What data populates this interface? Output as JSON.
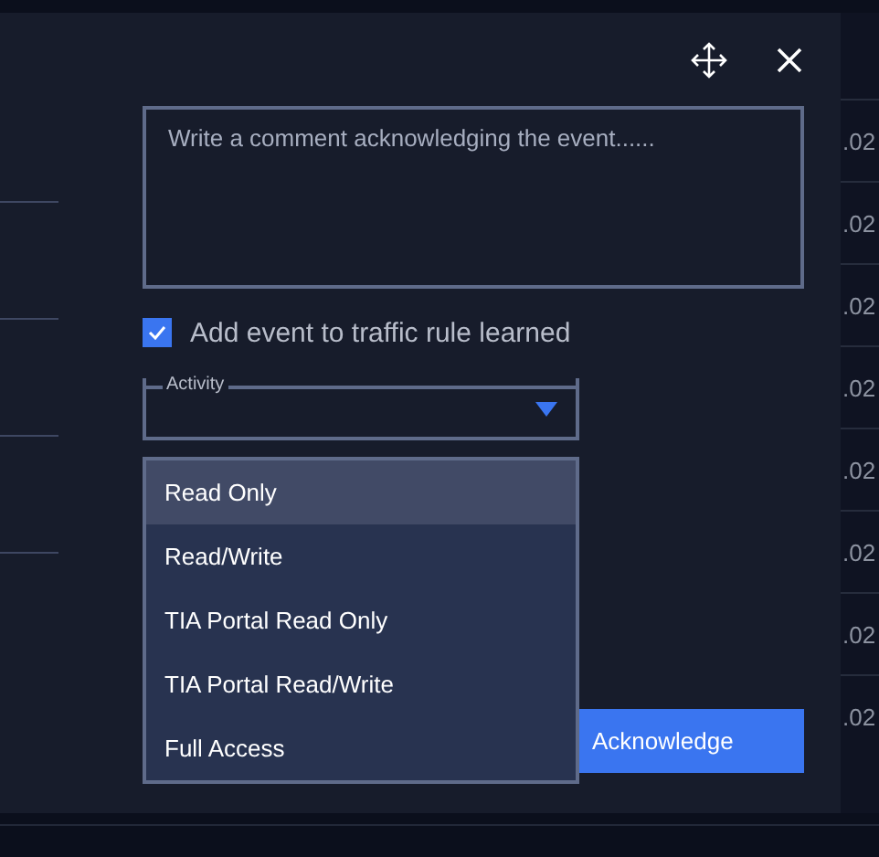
{
  "dialog": {
    "comment": {
      "placeholder": "Write a comment acknowledging the event......"
    },
    "learn_rule": {
      "label": "Add event to traffic rule learned",
      "checked": true
    },
    "activity": {
      "label": "Activity",
      "expanded": true,
      "options": [
        {
          "label": "Read Only",
          "selected": true
        },
        {
          "label": "Read/Write",
          "selected": false
        },
        {
          "label": "TIA Portal Read Only",
          "selected": false
        },
        {
          "label": "TIA Portal Read/Write",
          "selected": false
        },
        {
          "label": "Full Access",
          "selected": false
        }
      ]
    },
    "acknowledge_button": "Acknowledge"
  },
  "background_table": {
    "column_1": [
      ".02",
      ".02",
      ".02",
      ".02",
      ".02",
      ".02",
      ".02",
      ".02"
    ]
  }
}
